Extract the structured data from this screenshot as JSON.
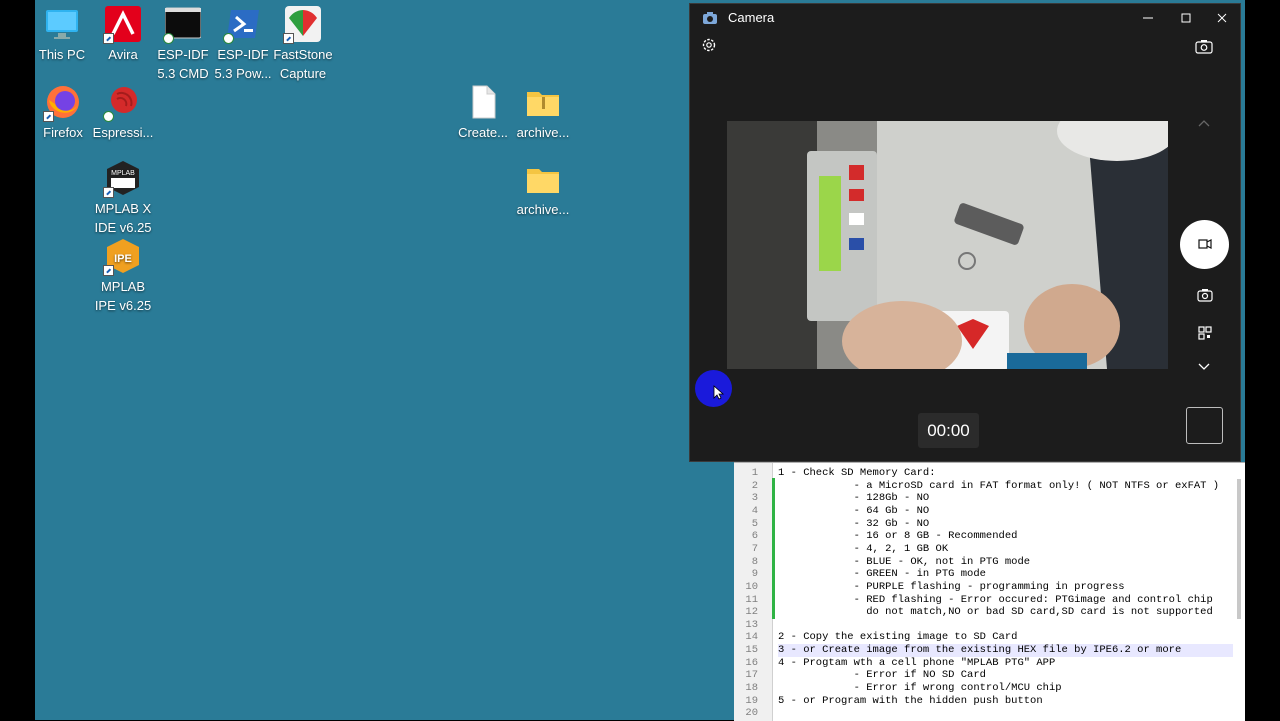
{
  "desktop": {
    "background": "#2a7b97",
    "icons": [
      {
        "label": "This PC",
        "icon": "monitor-icon"
      },
      {
        "label": "Avira",
        "icon": "avira-icon"
      },
      {
        "label": "ESP-IDF 5.3 CMD",
        "icon": "terminal-icon"
      },
      {
        "label": "ESP-IDF 5.3 Pow...",
        "icon": "powershell-icon"
      },
      {
        "label": "FastStone Capture",
        "icon": "faststone-icon"
      },
      {
        "label": "Firefox",
        "icon": "firefox-icon"
      },
      {
        "label": "Espressi...",
        "icon": "espressif-icon"
      },
      {
        "label": "MPLAB X IDE v6.25",
        "icon": "mplab-x-icon",
        "badge": "MPLAB"
      },
      {
        "label": "MPLAB IPE v6.25",
        "icon": "mplab-ipe-icon",
        "badge": "IPE"
      },
      {
        "label": "Create...",
        "icon": "file-icon"
      },
      {
        "label": "archive...",
        "icon": "zip-folder-icon"
      },
      {
        "label": "archive...",
        "icon": "folder-icon"
      }
    ]
  },
  "camera": {
    "title": "Camera",
    "timer": "00:00",
    "accent": "#ffffff"
  },
  "editor": {
    "lines": [
      {
        "n": "1",
        "text": "1 - Check SD Memory Card:"
      },
      {
        "n": "2",
        "text": "            - a MicroSD card in FAT format only! ( NOT NTFS or exFAT )"
      },
      {
        "n": "3",
        "text": "            - 128Gb - NO"
      },
      {
        "n": "4",
        "text": "            - 64 Gb - NO"
      },
      {
        "n": "5",
        "text": "            - 32 Gb - NO"
      },
      {
        "n": "6",
        "text": "            - 16 or 8 GB - Recommended"
      },
      {
        "n": "7",
        "text": "            - 4, 2, 1 GB OK"
      },
      {
        "n": "8",
        "text": "            - BLUE - OK, not in PTG mode"
      },
      {
        "n": "9",
        "text": "            - GREEN - in PTG mode"
      },
      {
        "n": "10",
        "text": "            - PURPLE flashing - programming in progress"
      },
      {
        "n": "11",
        "text": "            - RED flashing - Error occured: PTGimage and control chip"
      },
      {
        "n": "12",
        "text": "              do not match,NO or bad SD card,SD card is not supported"
      },
      {
        "n": "13",
        "text": ""
      },
      {
        "n": "14",
        "text": "2 - Copy the existing image to SD Card"
      },
      {
        "n": "15",
        "text": "3 - or Create image from the existing HEX file by IPE6.2 or more"
      },
      {
        "n": "16",
        "text": "4 - Progtam wth a cell phone \"MPLAB PTG\" APP"
      },
      {
        "n": "17",
        "text": "            - Error if NO SD Card"
      },
      {
        "n": "18",
        "text": "            - Error if wrong control/MCU chip"
      },
      {
        "n": "19",
        "text": "5 - or Program with the hidden push button"
      },
      {
        "n": "20",
        "text": ""
      }
    ],
    "highlight_line": 15,
    "change_color": "#2fb344"
  }
}
